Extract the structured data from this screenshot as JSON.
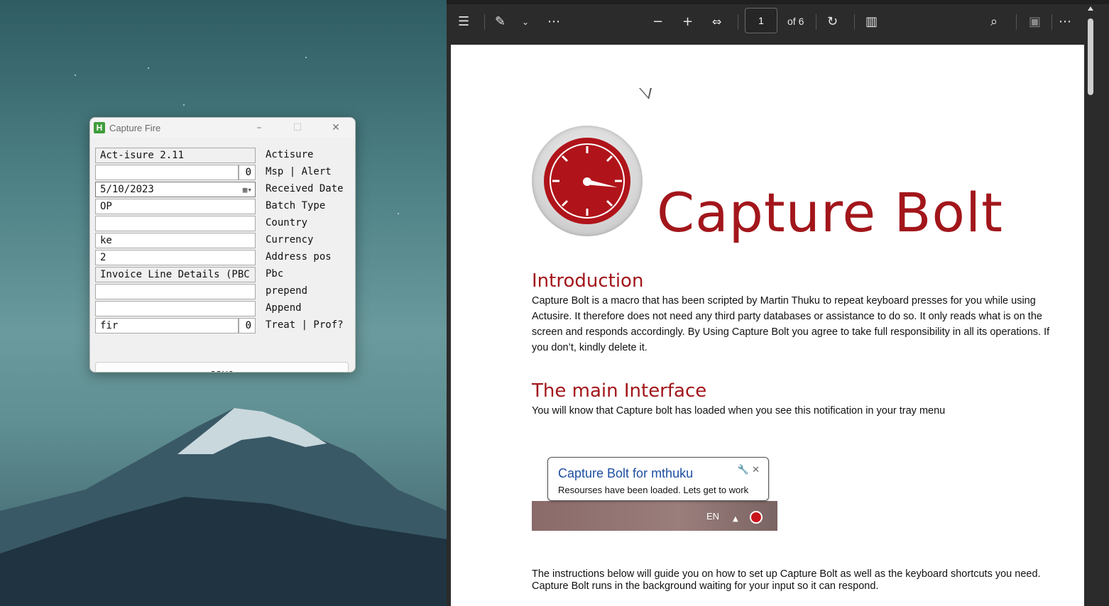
{
  "capture_fire": {
    "title": "Capture Fire",
    "app_icon_letter": "H",
    "controls": {
      "minimize": "–",
      "maximize": "☐",
      "close": "✕"
    },
    "fields": [
      {
        "value": "Act-isure 2.11",
        "label": "Actisure"
      },
      {
        "value": "",
        "num": "0",
        "label": "Msp | Alert"
      },
      {
        "value": "5/10/2023",
        "label": "Received Date"
      },
      {
        "value": "OP",
        "label": "Batch Type"
      },
      {
        "value": "",
        "label": "Country"
      },
      {
        "value": "ke",
        "label": "Currency"
      },
      {
        "value": "2",
        "label": "Address pos"
      },
      {
        "value": "Invoice Line Details (PBC",
        "label": "Pbc"
      },
      {
        "value": "",
        "label": "prepend"
      },
      {
        "value": "",
        "label": "Append"
      },
      {
        "value": "fir",
        "num": "0",
        "label": "Treat | Prof?"
      }
    ],
    "save_label": "save"
  },
  "pdf_viewer": {
    "page_current": "1",
    "page_of": "of 6",
    "toolbar_icons": [
      "contents-icon",
      "highlight-icon",
      "chevron-down-icon",
      "more-icon",
      "zoom-out-icon",
      "zoom-in-icon",
      "fit-width-icon",
      "rotate-icon",
      "page-view-icon",
      "search-icon",
      "save-icon",
      "more-icon"
    ],
    "document": {
      "title": "Capture Bolt",
      "intro_heading": "Introduction",
      "intro_text": "Capture Bolt is a macro that has been scripted by Martin Thuku to repeat keyboard presses for you while using Actusire. It therefore does not need any third party databases or assistance to do so. It only reads what is on the screen and responds accordingly. By Using Capture Bolt you agree to take full responsibility in all its operations. If you don’t, kindly delete it.",
      "main_heading": "The main Interface",
      "main_text": "You will know that Capture bolt has loaded when you see this notification in your tray menu",
      "notification_title": "Capture Bolt for mthuku",
      "notification_msg": "Resourses have been loaded. Lets get to work",
      "tray_lang": "EN",
      "instructions_text": "The instructions below will guide you on how to set up Capture Bolt as well as the keyboard shortcuts you need.  Capture Bolt runs in the background waiting for your input so it can respond."
    }
  },
  "colors": {
    "accent_red": "#a2161b",
    "link_blue": "#1e4fa0",
    "toolbar_bg": "#2b2b2b"
  }
}
